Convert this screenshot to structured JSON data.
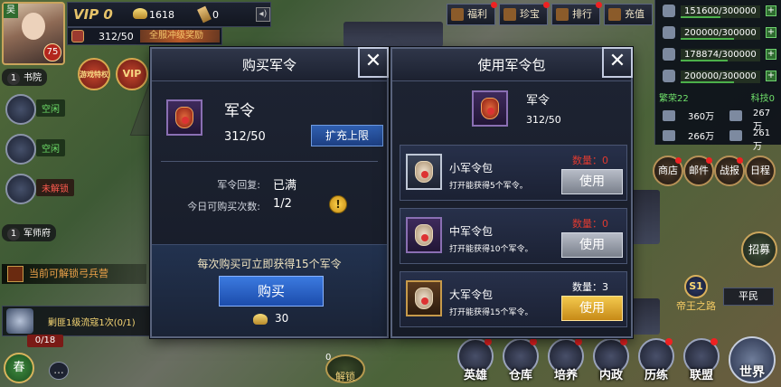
{
  "player": {
    "surname": "吴",
    "level": "75",
    "vip": "VIP 0",
    "gold": "1618",
    "scrolls": "0",
    "junling_bar": "312/50",
    "event_text": "全服冲级奖励"
  },
  "badges": {
    "event": "游戏特权",
    "vip": "VIP"
  },
  "left_panel": {
    "building_1": {
      "num": "1",
      "name": "书院"
    },
    "slots": [
      {
        "tag": "空闲",
        "color": "green"
      },
      {
        "tag": "空闲",
        "color": "green"
      },
      {
        "tag": "未解锁",
        "color": "red"
      }
    ],
    "building_2": {
      "num": "1",
      "name": "军师府"
    },
    "unlock_tip": "当前可解锁弓兵营",
    "quest": "剿匪1级流寇1次(0/1)",
    "quest_count": "0/18",
    "spring_label": "春",
    "chat_label": "..."
  },
  "top_menu": [
    {
      "label": "福利"
    },
    {
      "label": "珍宝"
    },
    {
      "label": "排行"
    },
    {
      "label": "充值"
    }
  ],
  "resources": [
    {
      "value": "151600/300000",
      "pct": 0.505
    },
    {
      "value": "200000/300000",
      "pct": 0.667
    },
    {
      "value": "178874/300000",
      "pct": 0.596
    },
    {
      "value": "200000/300000",
      "pct": 0.667
    }
  ],
  "res_line": {
    "left": "繁荣22",
    "right": "科技0"
  },
  "stats": [
    {
      "a": "360万",
      "b": "267万"
    },
    {
      "a": "266万",
      "b": "261万"
    }
  ],
  "right_buttons": [
    {
      "label": "商店"
    },
    {
      "label": "邮件"
    },
    {
      "label": "战报"
    },
    {
      "label": "日程"
    }
  ],
  "recruit_label": "招募",
  "road": {
    "badge": "S1",
    "label": "帝王之路"
  },
  "commoner": "平民",
  "bottom_bar": [
    {
      "label": "英雄"
    },
    {
      "label": "仓库"
    },
    {
      "label": "培养"
    },
    {
      "label": "内政"
    },
    {
      "label": "历练"
    },
    {
      "label": "联盟"
    }
  ],
  "world_label": "世界",
  "bottom_center": {
    "count": "0",
    "label": "解锁"
  },
  "buy_dialog": {
    "title": "购买军令",
    "close": "✕",
    "item_name": "军令",
    "item_count": "312/50",
    "expand_label": "扩充上限",
    "recover_label": "军令回复:",
    "recover_value": "已满",
    "daily_label": "今日可购买次数:",
    "daily_value": "1/2",
    "warn": "!",
    "note": "每次购买可立即获得15个军令",
    "buy_label": "购买",
    "price": "30"
  },
  "use_dialog": {
    "title": "使用军令包",
    "close": "✕",
    "item_name": "军令",
    "item_count": "312/50",
    "packs": [
      {
        "name": "小军令包",
        "desc": "打开能获得5个军令。",
        "qty": "数量：0",
        "button": "使用",
        "active": false,
        "rarity": "white"
      },
      {
        "name": "中军令包",
        "desc": "打开能获得10个军令。",
        "qty": "数量：0",
        "button": "使用",
        "active": false,
        "rarity": "purple"
      },
      {
        "name": "大军令包",
        "desc": "打开能获得15个军令。",
        "qty": "数量：3",
        "button": "使用",
        "active": true,
        "rarity": "gold"
      }
    ]
  }
}
